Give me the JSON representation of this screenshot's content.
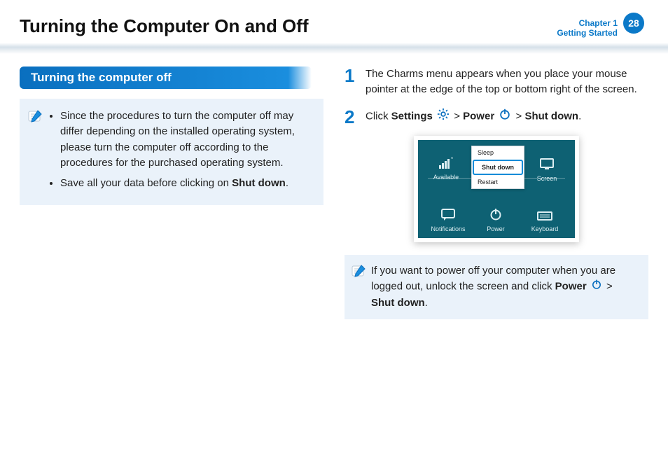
{
  "header": {
    "title": "Turning the Computer On and Off",
    "chapter_line1": "Chapter 1",
    "chapter_line2": "Getting Started",
    "page_number": "28"
  },
  "section": {
    "heading": "Turning the computer off"
  },
  "note": {
    "bullets": [
      {
        "pre": "Since the procedures to turn the computer off may differ depending on the installed operating system, please turn the computer off according to the procedures for the purchased operating system.",
        "bold": "",
        "post": ""
      },
      {
        "pre": "Save all your data before clicking on ",
        "bold": "Shut down",
        "post": "."
      }
    ]
  },
  "steps": {
    "s1": {
      "num": "1",
      "text": "The Charms menu appears when you place your mouse pointer at the edge of the top or bottom right of the screen."
    },
    "s2": {
      "num": "2",
      "pre": " Click ",
      "settings": "Settings",
      "gt1": " > ",
      "power": "Power",
      "gt2": " > ",
      "shut": "Shut down",
      "post": "."
    }
  },
  "charms": {
    "tiles": {
      "available": "Available",
      "screen": "Screen",
      "notifications": "Notifications",
      "power": "Power",
      "keyboard": "Keyboard"
    },
    "menu": {
      "sleep": "Sleep",
      "shutdown": "Shut down",
      "restart": "Restart"
    }
  },
  "tip": {
    "pre": "If you want to power off your computer when you are logged out, unlock the screen and click ",
    "power": "Power",
    "gt": " > ",
    "shut": "Shut down",
    "post": "."
  }
}
